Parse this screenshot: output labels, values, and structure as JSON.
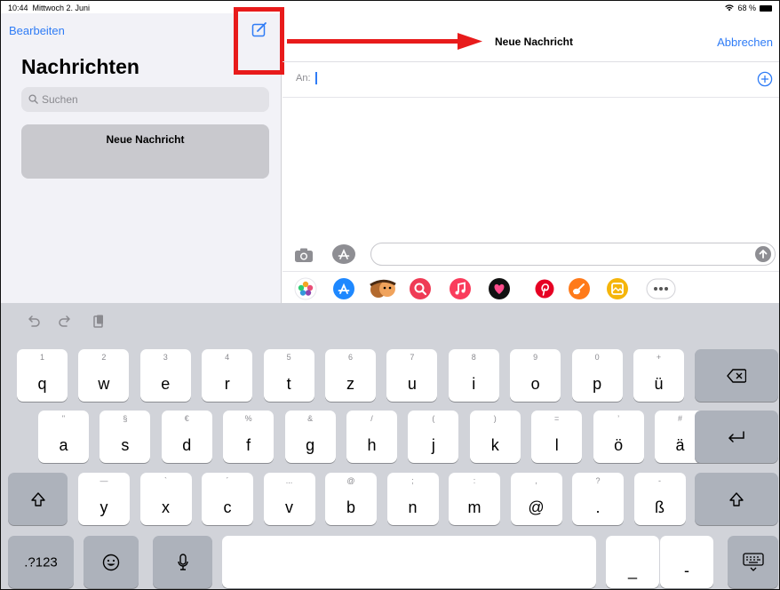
{
  "status_bar": {
    "time": "10:44",
    "date": "Mittwoch 2. Juni",
    "battery": "68 %"
  },
  "sidebar": {
    "edit_label": "Bearbeiten",
    "title": "Nachrichten",
    "search_placeholder": "Suchen",
    "conversation": "Neue Nachricht"
  },
  "compose": {
    "title": "Neue Nachricht",
    "cancel_label": "Abbrechen",
    "to_label": "An:"
  },
  "colors": {
    "accent": "#2f7cf6",
    "annotation": "#e81b1b"
  },
  "app_drawer_icons": [
    "photos-icon",
    "appstore-icon",
    "memoji-icon",
    "image-search-icon",
    "music-icon",
    "digital-touch-icon",
    "pinterest-icon",
    "garageband-icon",
    "stickers-icon",
    "more-icon"
  ],
  "keyboard": {
    "row1": [
      {
        "hint": "1",
        "key": "q"
      },
      {
        "hint": "2",
        "key": "w"
      },
      {
        "hint": "3",
        "key": "e"
      },
      {
        "hint": "4",
        "key": "r"
      },
      {
        "hint": "5",
        "key": "t"
      },
      {
        "hint": "6",
        "key": "z"
      },
      {
        "hint": "7",
        "key": "u"
      },
      {
        "hint": "8",
        "key": "i"
      },
      {
        "hint": "9",
        "key": "o"
      },
      {
        "hint": "0",
        "key": "p"
      },
      {
        "hint": "+",
        "key": "ü"
      }
    ],
    "row2": [
      {
        "hint": "\"",
        "key": "a"
      },
      {
        "hint": "§",
        "key": "s"
      },
      {
        "hint": "€",
        "key": "d"
      },
      {
        "hint": "%",
        "key": "f"
      },
      {
        "hint": "&",
        "key": "g"
      },
      {
        "hint": "/",
        "key": "h"
      },
      {
        "hint": "(",
        "key": "j"
      },
      {
        "hint": ")",
        "key": "k"
      },
      {
        "hint": "=",
        "key": "l"
      },
      {
        "hint": "’",
        "key": "ö"
      },
      {
        "hint": "#",
        "key": "ä"
      }
    ],
    "row3": [
      {
        "hint": "—",
        "key": "y"
      },
      {
        "hint": "`",
        "key": "x"
      },
      {
        "hint": "´",
        "key": "c"
      },
      {
        "hint": "...",
        "key": "v"
      },
      {
        "hint": "@",
        "key": "b"
      },
      {
        "hint": ";",
        "key": "n"
      },
      {
        "hint": ":",
        "key": "m"
      },
      {
        "hint": ",",
        "key": "@"
      },
      {
        "hint": "?",
        "key": "."
      },
      {
        "hint": "-",
        "key": "ß"
      }
    ],
    "numbers_label": ".?123",
    "underscore_key": "_",
    "dash_key": "-"
  }
}
